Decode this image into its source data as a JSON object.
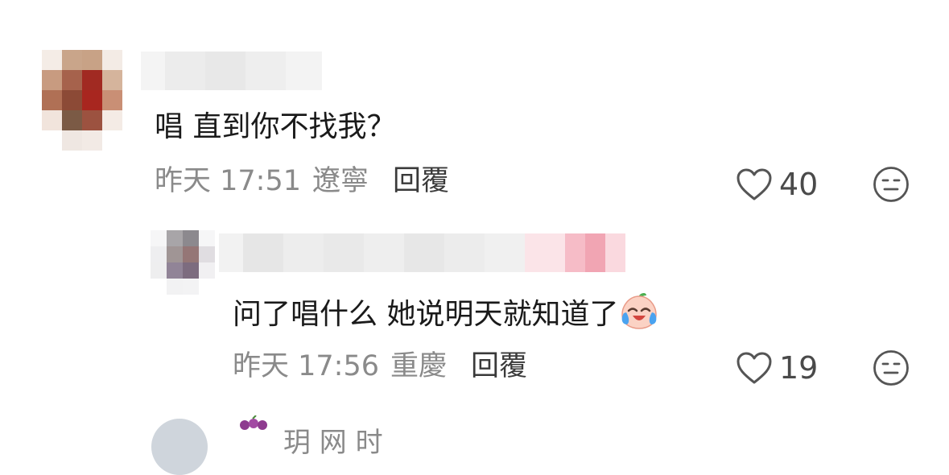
{
  "comments": [
    {
      "text": "唱 直到你不找我？",
      "time": "昨天 17:51",
      "location": "遼寧",
      "reply_label": "回覆",
      "likes": "40"
    },
    {
      "text": "问了唱什么 她说明天就知道了",
      "time": "昨天 17:56",
      "location": "重慶",
      "reply_label": "回覆",
      "likes": "19"
    }
  ],
  "next_comment": {
    "name_partial": "玥 网 时"
  },
  "icons": {
    "like": "heart-outline-icon",
    "reaction": "neutral-face-icon",
    "emoji": "crying-laughing-peach-emoji"
  }
}
